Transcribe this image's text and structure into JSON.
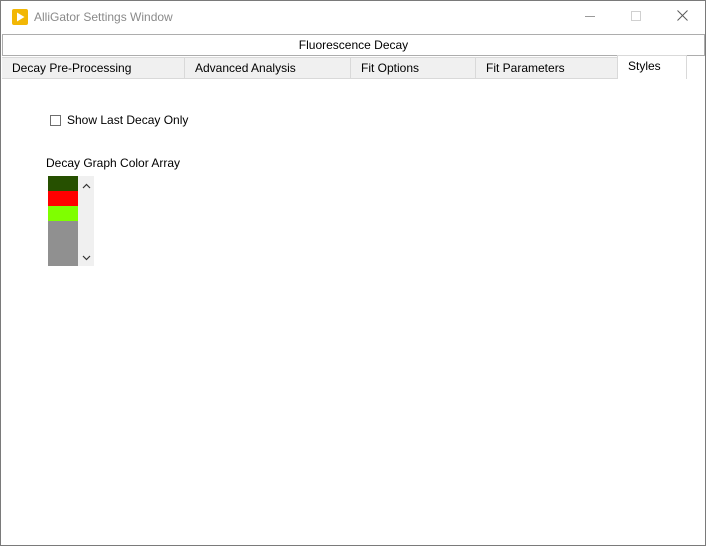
{
  "window": {
    "title": "AlliGator Settings Window",
    "accent_color": "#f2b705",
    "controls": {
      "minimize_icon": "minimize-icon",
      "maximize_icon": "maximize-icon",
      "close_icon": "close-icon"
    }
  },
  "header_tab": {
    "label": "Fluorescence Decay"
  },
  "tabs": [
    {
      "label": "Decay Pre-Processing",
      "active": false
    },
    {
      "label": "Advanced Analysis",
      "active": false
    },
    {
      "label": "Fit Options",
      "active": false
    },
    {
      "label": "Fit Parameters",
      "active": false
    },
    {
      "label": "Styles",
      "active": true
    }
  ],
  "styles": {
    "show_last_decay_only": {
      "label": "Show Last Decay Only",
      "checked": false
    },
    "decay_graph_color_array": {
      "label": "Decay Graph Color Array",
      "colors": [
        "#265000",
        "#ff0000",
        "#7fff00",
        "#909090"
      ]
    }
  }
}
